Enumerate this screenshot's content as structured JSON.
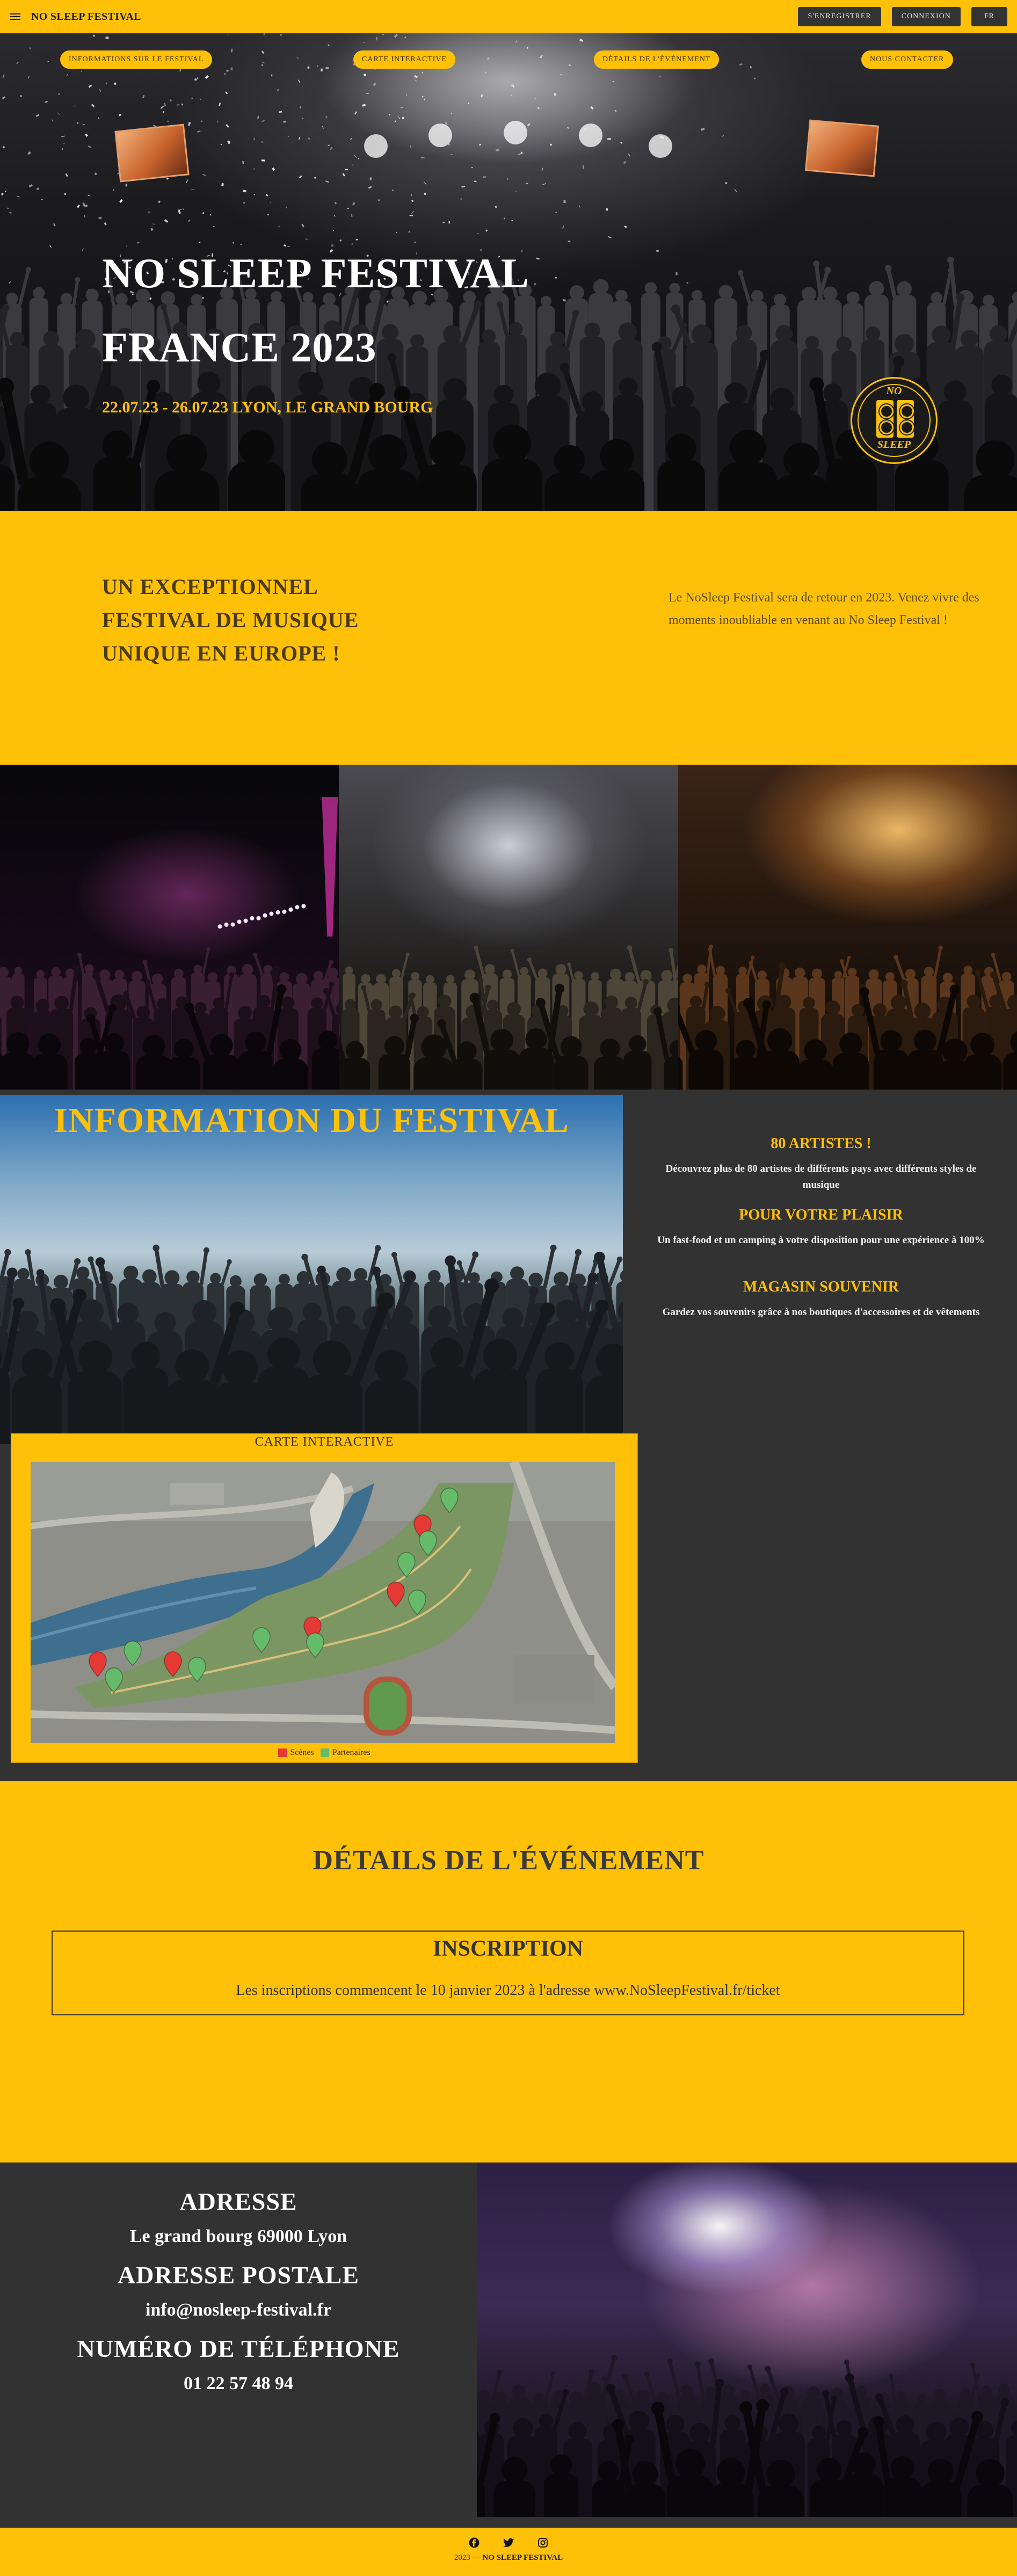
{
  "header": {
    "brand": "NO SLEEP FESTIVAL",
    "register_label": "S'ENREGISTRER",
    "login_label": "CONNEXION",
    "lang_label": "FR"
  },
  "hero": {
    "nav": [
      "INFORMATIONS SUR LE FESTIVAL",
      "CARTE INTERACTIVE",
      "DÉTAILS DE L'ÉVÉNEMENT",
      "NOUS CONTACTER"
    ],
    "title_line1": "NO SLEEP FESTIVAL",
    "title_line2": "FRANCE 2023",
    "subtitle": "22.07.23 - 26.07.23 LYON, LE GRAND BOURG",
    "logo_top": "NO",
    "logo_bottom": "SLEEP"
  },
  "intro": {
    "heading": "UN EXCEPTIONNEL FESTIVAL DE MUSIQUE UNIQUE EN EUROPE !",
    "text": "Le NoSleep Festival sera de retour en 2023. Venez vivre des moments inoubliable en venant au No Sleep Festival !"
  },
  "info": {
    "title": "INFORMATION DU FESTIVAL",
    "features": [
      {
        "title": "80 ARTISTES !",
        "text": "Découvrez plus de 80 artistes de différents pays avec différents styles de musique"
      },
      {
        "title": "POUR VOTRE PLAISIR",
        "text": "Un fast-food et un camping à votre disposition pour une expérience à 100%"
      },
      {
        "title": "MAGASIN SOUVENIR",
        "text": "Gardez vos souvenirs grâce à nos boutiques d'accessoires et de vêtements"
      }
    ],
    "map_caption": "CARTE INTERACTIVE",
    "legend_stages": "Scènes",
    "legend_partners": "Partenaires"
  },
  "details": {
    "title": "DÉTAILS DE L'ÉVÉNEMENT",
    "reg_title": "INSCRIPTION",
    "reg_text": "Les inscriptions commencent le 10 janvier 2023 à l'adresse www.NoSleepFestival.fr/ticket"
  },
  "contact": {
    "address_label": "ADRESSE",
    "address_value": "Le grand bourg 69000 Lyon",
    "postal_label": "ADRESSE POSTALE",
    "postal_value": "info@nosleep-festival.fr",
    "phone_label": "NUMÉRO DE TÉLÉPHONE",
    "phone_value": "01 22 57 48 94"
  },
  "footer": {
    "icons": [
      "facebook-icon",
      "twitter-icon",
      "instagram-icon"
    ],
    "copyright_prefix": "2023 —",
    "copyright_brand": "NO SLEEP FESTIVAL"
  },
  "colors": {
    "accent": "#ffc107",
    "dark": "#333233",
    "stage_marker": "#e53935",
    "partner_marker": "#66bb6a"
  }
}
